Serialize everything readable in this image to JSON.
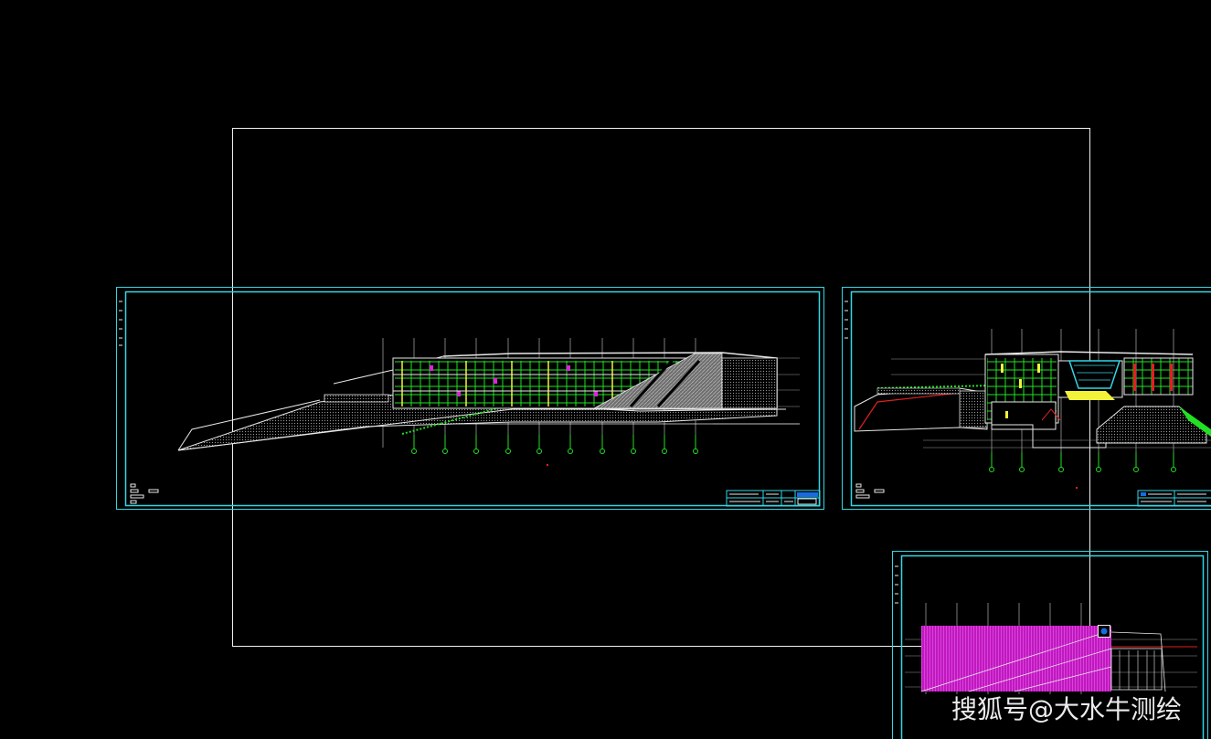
{
  "canvas": {
    "background_color": "#000000",
    "colors": {
      "frame": "#33d6e6",
      "line": "#e8e8e8",
      "green": "#22e022",
      "yellow": "#f2f23a",
      "magenta": "#e020e0",
      "hatch": "#8a8a8a",
      "red": "#e02020",
      "viewport_rect": "#f0f0f0",
      "grip": "#1a6be0"
    }
  },
  "watermark": {
    "text": "搜狐号@大水牛测绘",
    "icon": "none"
  }
}
